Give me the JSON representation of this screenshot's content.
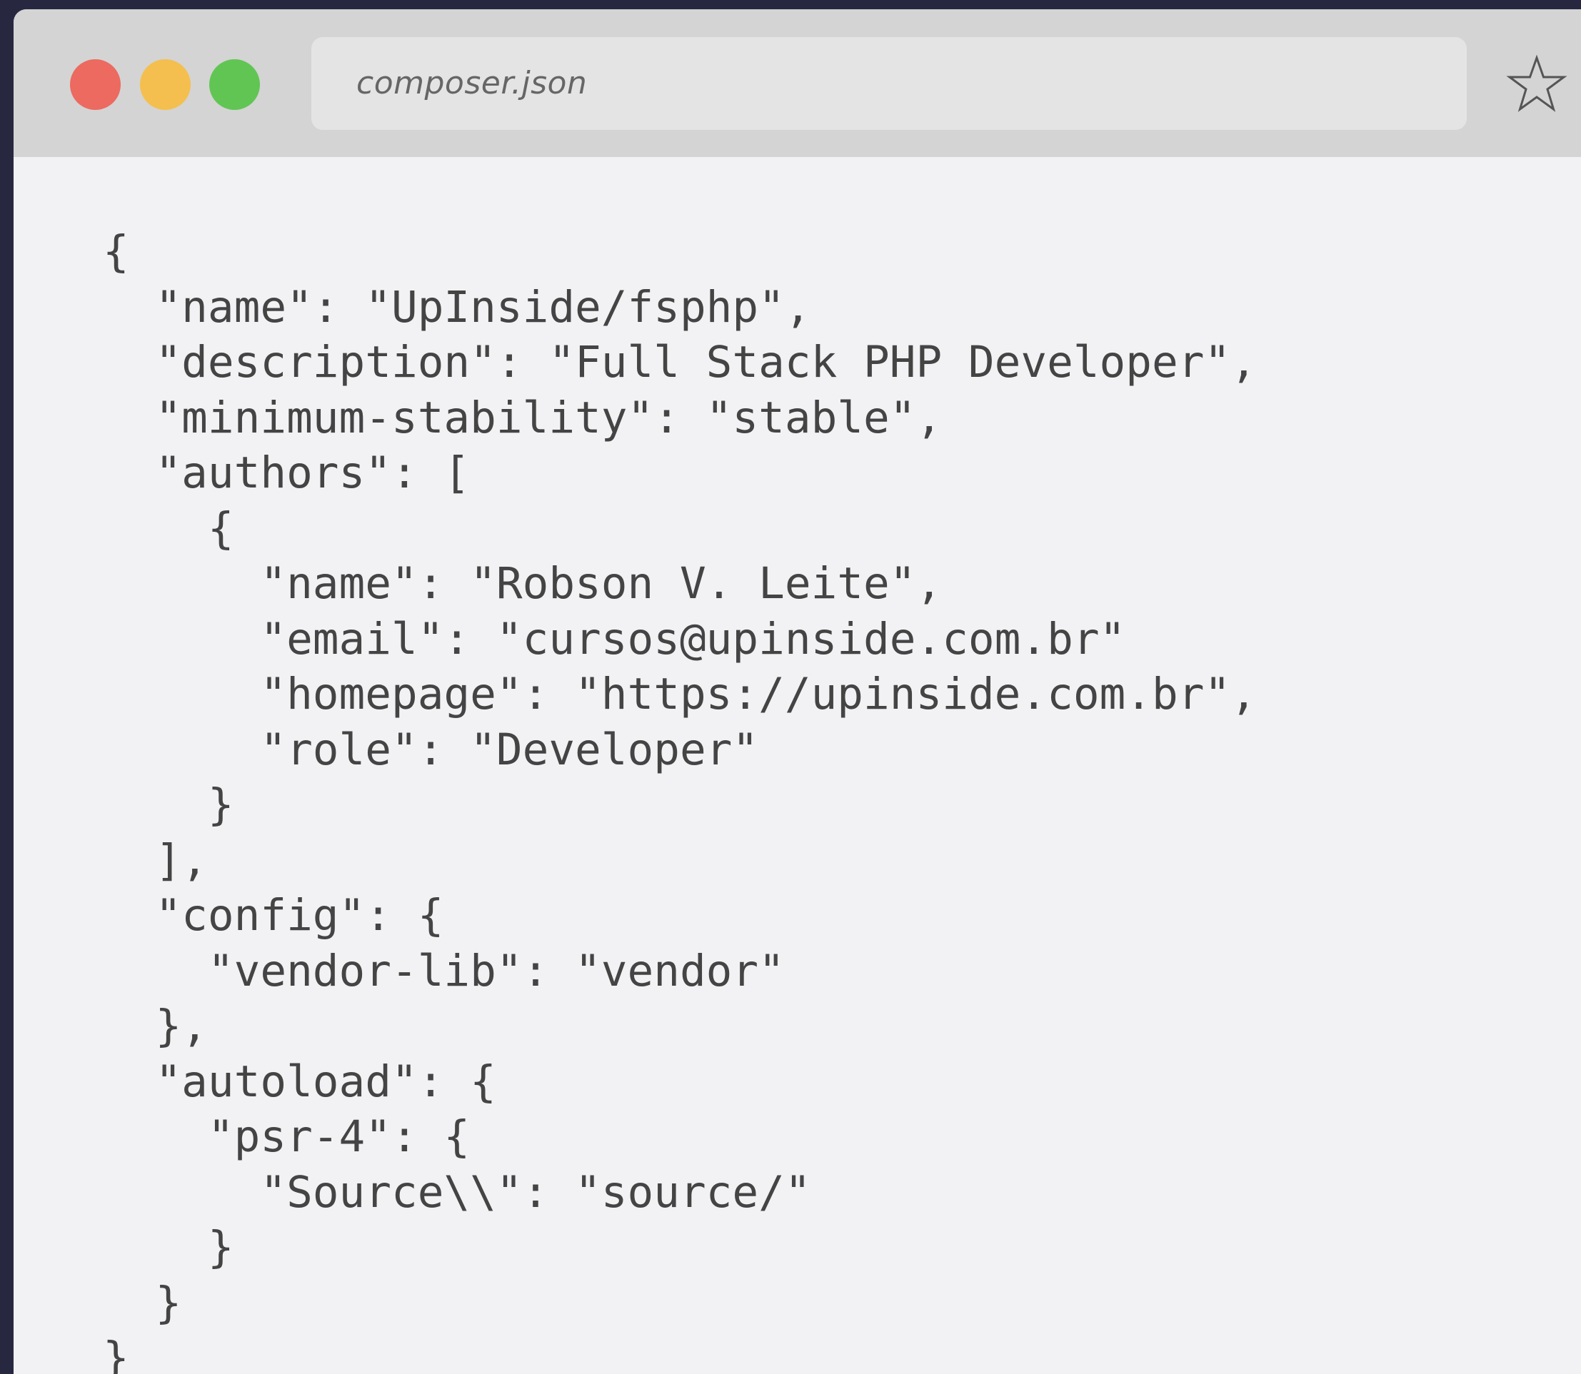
{
  "window": {
    "file_name": "composer.json",
    "controls": [
      {
        "name": "close",
        "color": "#ec6a5f"
      },
      {
        "name": "minimize",
        "color": "#f4bf4f"
      },
      {
        "name": "maximize",
        "color": "#61c554"
      }
    ],
    "bookmark_icon": "star-icon"
  },
  "code": {
    "lines": [
      "{",
      "  \"name\": \"UpInside/fsphp\",",
      "  \"description\": \"Full Stack PHP Developer\",",
      "  \"minimum-stability\": \"stable\",",
      "  \"authors\": [",
      "    {",
      "      \"name\": \"Robson V. Leite\",",
      "      \"email\": \"cursos@upinside.com.br\"",
      "      \"homepage\": \"https://upinside.com.br\",",
      "      \"role\": \"Developer\"",
      "    }",
      "  ],",
      "  \"config\": {",
      "    \"vendor-lib\": \"vendor\"",
      "  },",
      "  \"autoload\": {",
      "    \"psr-4\": {",
      "      \"Source\\\\\": \"source/\"",
      "    }",
      "  }",
      "}"
    ]
  }
}
